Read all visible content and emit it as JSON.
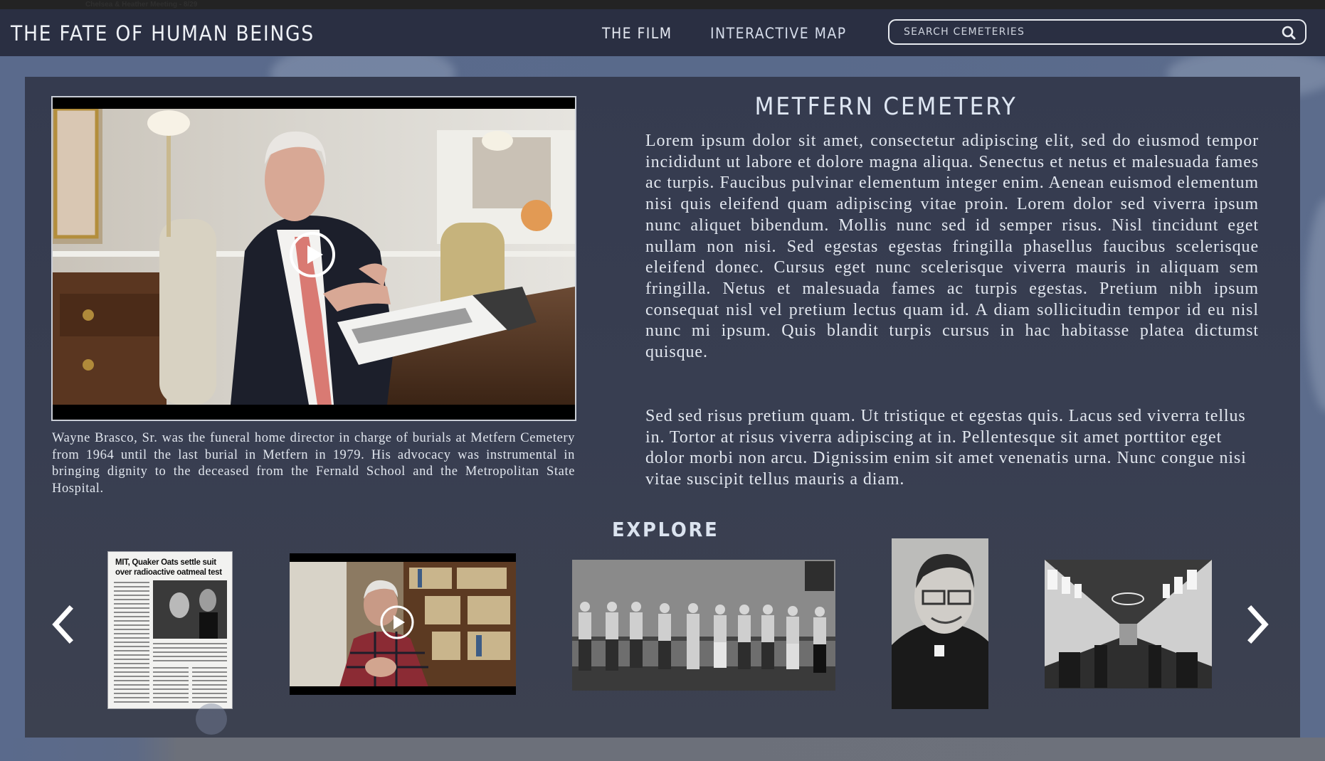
{
  "window": {
    "top_strip_text": "Chelsea & Heather Meeting - 8/29"
  },
  "header": {
    "site_title": "THE FATE OF HUMAN BEINGS",
    "nav": [
      {
        "label": "THE FILM"
      },
      {
        "label": "INTERACTIVE MAP"
      }
    ],
    "search": {
      "placeholder": "SEARCH CEMETERIES",
      "value": "",
      "icon": "search-icon"
    }
  },
  "main": {
    "video": {
      "description": "Interview video still: man in suit seated at a dining table with a binder of newspaper clippings",
      "play_icon": "play-icon"
    },
    "caption": "Wayne Brasco, Sr. was the funeral home director in charge of burials at Metfern Cemetery from 1964 until the last burial in Metfern in 1979. His advocacy was instrumental in bringing dignity to the deceased from the Fernald School and the Metropolitan State Hospital.",
    "cemetery_title": "METFERN CEMETERY",
    "paragraphs": [
      "Lorem ipsum dolor sit amet, consectetur adipiscing elit, sed do eiusmod tempor incididunt ut labore et dolore magna aliqua. Senectus et netus et malesuada fames ac turpis. Faucibus pulvinar elementum integer enim. Aenean euismod elementum nisi quis eleifend quam adipiscing vitae proin. Lorem dolor sed viverra ipsum nunc aliquet bibendum. Mollis nunc sed id semper risus. Nisl tincidunt eget nullam non nisi. Sed egestas egestas fringilla phasellus faucibus scelerisque eleifend donec. Cursus eget nunc scelerisque viverra mauris in aliquam sem fringilla. Netus et malesuada fames ac turpis egestas. Pretium nibh ipsum consequat nisl vel pretium lectus quam id. A diam sollicitudin tempor id eu nisl nunc mi ipsum. Quis blandit turpis cursus in hac habi­tasse platea dictumst quisque.",
      "Sed sed risus pretium quam. Ut tristique et egestas quis. Lacus sed viverra tellus in. Tortor at risus viverra adipiscing at in. Pellentesque sit amet porttitor eget dolor morbi non arcu. Dignissim enim sit amet venenatis urna. Nunc congue nisi vitae suscipit tellus mauris a diam."
    ],
    "explore": {
      "title": "EXPLORE",
      "prev_icon": "chevron-left-icon",
      "next_icon": "chevron-right-icon",
      "items": [
        {
          "type": "newspaper-clipping",
          "headline": "MIT, Quaker Oats settle suit over radioactive oatmeal test"
        },
        {
          "type": "video",
          "description": "Older man in plaid shirt in front of bookshelves"
        },
        {
          "type": "photo",
          "description": "Row of boys standing in front of a chalkboard"
        },
        {
          "type": "photo",
          "description": "Portrait of a priest in clerical collar"
        },
        {
          "type": "photo",
          "description": "Large institutional dining hall"
        }
      ]
    }
  },
  "colors": {
    "header_bg": "#2a2f42",
    "panel_bg": "#363c50",
    "page_bg": "#5a6a8c",
    "text": "#e2e7ef"
  }
}
